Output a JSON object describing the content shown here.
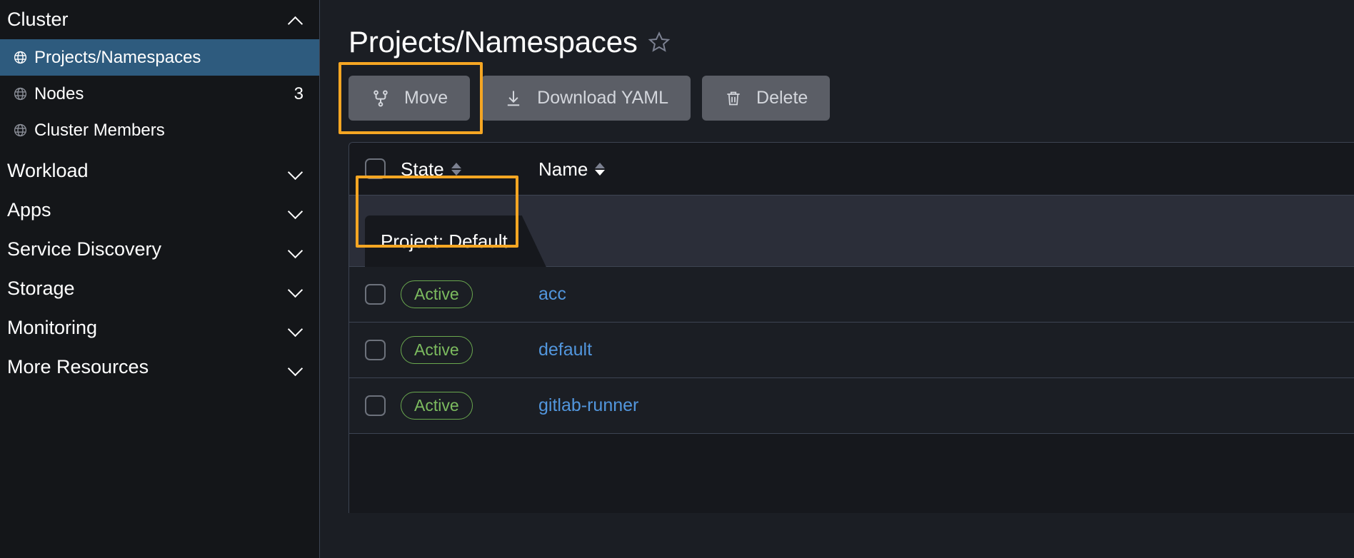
{
  "sidebar": {
    "groups": [
      {
        "label": "Cluster",
        "chevron": "chevron-up-icon",
        "expanded": true,
        "items": [
          {
            "label": "Projects/Namespaces",
            "icon": "globe-icon",
            "count": "",
            "active": true
          },
          {
            "label": "Nodes",
            "icon": "globe-icon",
            "count": "3",
            "active": false
          },
          {
            "label": "Cluster Members",
            "icon": "globe-icon",
            "count": "",
            "active": false
          }
        ]
      },
      {
        "label": "Workload",
        "chevron": "chevron-down-icon",
        "expanded": false,
        "items": []
      },
      {
        "label": "Apps",
        "chevron": "chevron-down-icon",
        "expanded": false,
        "items": []
      },
      {
        "label": "Service Discovery",
        "chevron": "chevron-down-icon",
        "expanded": false,
        "items": []
      },
      {
        "label": "Storage",
        "chevron": "chevron-down-icon",
        "expanded": false,
        "items": []
      },
      {
        "label": "Monitoring",
        "chevron": "chevron-down-icon",
        "expanded": false,
        "items": []
      },
      {
        "label": "More Resources",
        "chevron": "chevron-down-icon",
        "expanded": false,
        "items": []
      }
    ]
  },
  "main": {
    "title": "Projects/Namespaces",
    "favorite_icon": "star-outline-icon",
    "actions": [
      {
        "label": "Move",
        "icon": "branch-move-icon",
        "highlighted": true
      },
      {
        "label": "Download YAML",
        "icon": "download-icon",
        "highlighted": false
      },
      {
        "label": "Delete",
        "icon": "trash-icon",
        "highlighted": false
      }
    ],
    "table": {
      "select_all_checkbox": false,
      "columns": [
        {
          "label": "State",
          "sortable": true,
          "sort_active": false
        },
        {
          "label": "Name",
          "sortable": true,
          "sort_active": true
        }
      ],
      "groups": [
        {
          "label": "Project: Default",
          "highlighted": true,
          "rows": [
            {
              "checked": false,
              "state": "Active",
              "name": "acc"
            },
            {
              "checked": false,
              "state": "Active",
              "name": "default"
            },
            {
              "checked": false,
              "state": "Active",
              "name": "gitlab-runner"
            }
          ]
        }
      ]
    }
  },
  "colors": {
    "sidebar_bg": "#141619",
    "main_bg": "#1b1e24",
    "active_nav": "#2e5b7e",
    "highlight": "#f5a623",
    "link": "#5296dd",
    "badge_active": "#7cbb5f",
    "button_bg": "#5b5e66"
  }
}
